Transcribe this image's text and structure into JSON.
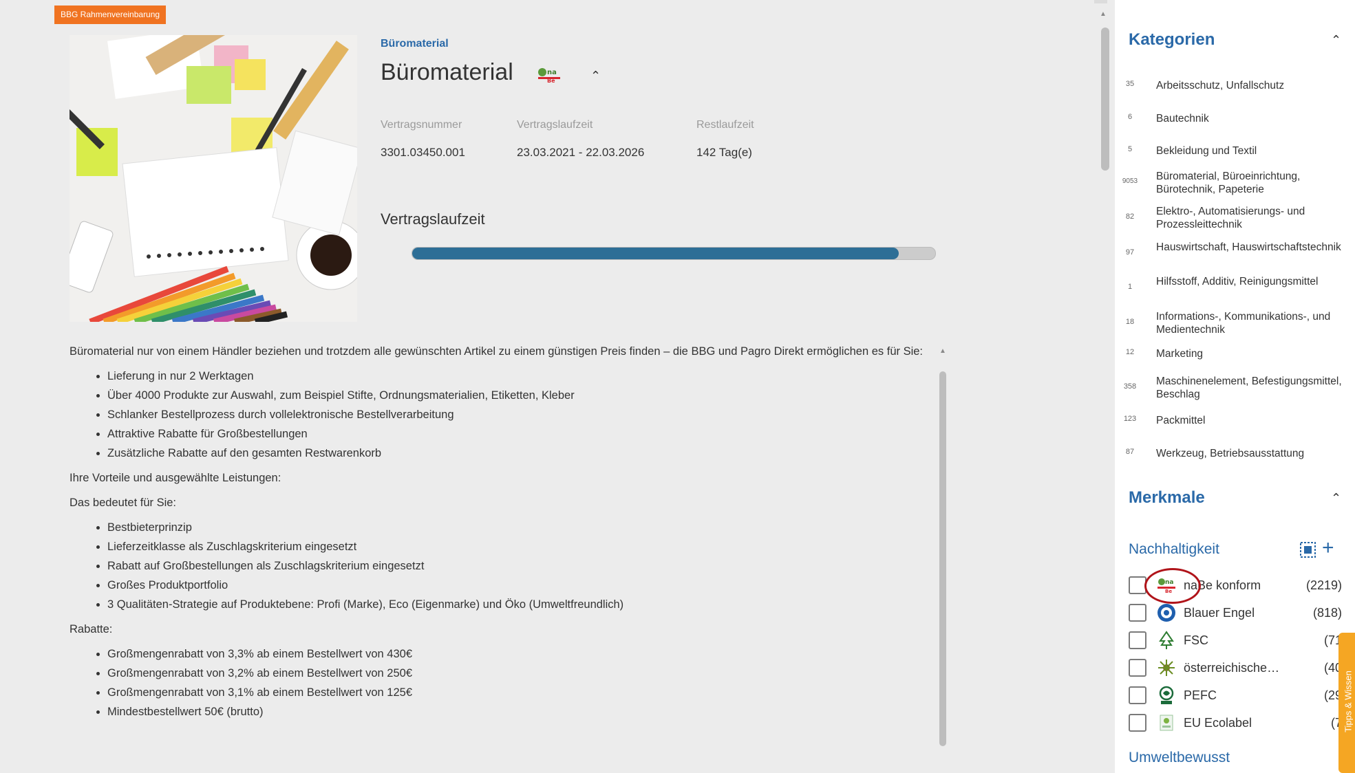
{
  "badge": "BBG Rahmenvereinbarung",
  "contract": {
    "category_link": "Büromaterial",
    "title": "Büromaterial",
    "meta": {
      "labels": [
        "Vertragsnummer",
        "Vertragslaufzeit",
        "Restlaufzeit"
      ],
      "values": [
        "3301.03450.001",
        "23.03.2021 - 22.03.2026",
        "142 Tag(e)"
      ]
    },
    "laufzeit_heading": "Vertragslaufzeit",
    "progress_fraction": 0.93
  },
  "description": {
    "intro": "Büromaterial nur von einem Händler beziehen und trotzdem alle gewünschten Artikel zu einem günstigen Preis finden – die BBG und Pagro Direkt ermöglichen es für Sie:",
    "list1": [
      "Lieferung in nur 2 Werktagen",
      "Über 4000 Produkte zur Auswahl, zum Beispiel Stifte, Ordnungsmaterialien, Etiketten, Kleber",
      "Schlanker Bestellprozess durch vollelektronische Bestellverarbeitung",
      "Attraktive Rabatte für Großbestellungen",
      "Zusätzliche Rabatte auf den gesamten Restwarenkorb"
    ],
    "vorteile": "Ihre Vorteile und ausgewählte Leistungen:",
    "bedeutet": "Das bedeutet für Sie:",
    "list2": [
      "Bestbieterprinzip",
      "Lieferzeitklasse als Zuschlagskriterium eingesetzt",
      "Rabatt auf Großbestellungen als Zuschlagskriterium eingesetzt",
      "Großes Produktportfolio",
      "3 Qualitäten-Strategie auf Produktebene: Profi (Marke), Eco (Eigenmarke) und Öko (Umweltfreundlich)"
    ],
    "rabatte": "Rabatte:",
    "list3": [
      "Großmengenrabatt von 3,3% ab einem Bestellwert von 430€",
      "Großmengenrabatt von 3,2% ab einem Bestellwert von 250€",
      "Großmengenrabatt von 3,1% ab einem Bestellwert von 125€",
      "Mindestbestellwert 50€ (brutto)"
    ]
  },
  "sidebar": {
    "kategorien_heading": "Kategorien",
    "categories": [
      {
        "count": "35",
        "label": "Arbeitsschutz, Unfallschutz"
      },
      {
        "count": "6",
        "label": "Bautechnik"
      },
      {
        "count": "5",
        "label": "Bekleidung und Textil"
      },
      {
        "count": "9053",
        "label": "Büromaterial, Büroeinrichtung, Bürotechnik, Papeterie"
      },
      {
        "count": "82",
        "label": "Elektro-, Automatisierungs- und Prozessleittechnik"
      },
      {
        "count": "97",
        "label": "Hauswirtschaft, Hauswirtschaftstechnik"
      },
      {
        "count": "1",
        "label": "Hilfsstoff, Additiv, Reinigungsmittel"
      },
      {
        "count": "18",
        "label": "Informations-, Kommunikations-, und Medientechnik"
      },
      {
        "count": "12",
        "label": "Marketing"
      },
      {
        "count": "358",
        "label": "Maschinenelement, Befestigungsmittel, Beschlag"
      },
      {
        "count": "123",
        "label": "Packmittel"
      },
      {
        "count": "87",
        "label": "Werkzeug, Betriebsausstattung"
      }
    ],
    "merkmale_heading": "Merkmale",
    "nachhaltigkeit_label": "Nachhaltigkeit",
    "merkmale": [
      {
        "label": "naBe konform",
        "count": "(2219)",
        "icon": "nabe-logo-icon"
      },
      {
        "label": "Blauer Engel",
        "count": "(818)",
        "icon": "blauer-engel-icon"
      },
      {
        "label": "FSC",
        "count": "(71",
        "icon": "fsc-tree-icon"
      },
      {
        "label": "österreichisches...",
        "count": "(40",
        "icon": "austrian-ecolabel-icon"
      },
      {
        "label": "PEFC",
        "count": "(29",
        "icon": "pefc-icon"
      },
      {
        "label": "EU Ecolabel",
        "count": "(7",
        "icon": "eu-ecolabel-icon"
      }
    ],
    "umwelt_label": "Umweltbewusst"
  },
  "tipps_tab": "Tipps & Wissen",
  "colors": {
    "accent_blue": "#2a69a8",
    "badge_orange": "#f07321",
    "progress_blue": "#2d6e96",
    "highlight_red": "#b0141a",
    "tab_orange": "#f5a623"
  }
}
